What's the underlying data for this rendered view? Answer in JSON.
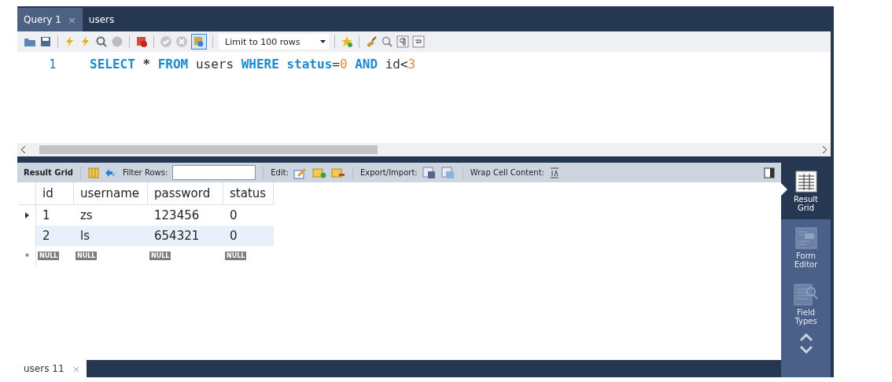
{
  "query_tabs": [
    {
      "label": "Query 1",
      "selected": true,
      "close": "×"
    },
    {
      "label": "users",
      "selected": false
    }
  ],
  "toolbar": {
    "limit": "Limit to 100 rows",
    "toggle_on": true
  },
  "editor": {
    "line_number": "1",
    "tokens": [
      {
        "text": "SELECT ",
        "kind": "keyword"
      },
      {
        "text": "* ",
        "kind": "operator"
      },
      {
        "text": "FROM ",
        "kind": "keyword"
      },
      {
        "text": "users ",
        "kind": "identifier"
      },
      {
        "text": "WHERE ",
        "kind": "keyword"
      },
      {
        "text": "status",
        "kind": "keyword"
      },
      {
        "text": "=",
        "kind": "identifier"
      },
      {
        "text": "0 ",
        "kind": "number"
      },
      {
        "text": "AND ",
        "kind": "keyword"
      },
      {
        "text": "id<",
        "kind": "identifier"
      },
      {
        "text": "3",
        "kind": "number"
      }
    ]
  },
  "result_toolbar": {
    "result_grid": "Result Grid",
    "filter_label": "Filter Rows:",
    "edit_label": "Edit:",
    "export_label": "Export/Import:",
    "wrap_label": "Wrap Cell Content:"
  },
  "grid": {
    "columns": [
      "id",
      "username",
      "password",
      "status"
    ],
    "rows": [
      {
        "cells": [
          "1",
          "zs",
          "123456",
          "0"
        ],
        "current": true,
        "selected": false
      },
      {
        "cells": [
          "2",
          "ls",
          "654321",
          "0"
        ],
        "current": false,
        "selected": true
      }
    ],
    "new_row": {
      "marker": "*",
      "cells": [
        "NULL",
        "NULL",
        "NULL",
        "NULL"
      ]
    }
  },
  "side_panel": [
    {
      "label": "Result Grid",
      "selected": true
    },
    {
      "label": "Form Editor",
      "selected": false
    },
    {
      "label": "Field Types",
      "selected": false
    }
  ],
  "result_tabs": [
    {
      "label": "users 11",
      "selected": true,
      "close": "×"
    }
  ]
}
